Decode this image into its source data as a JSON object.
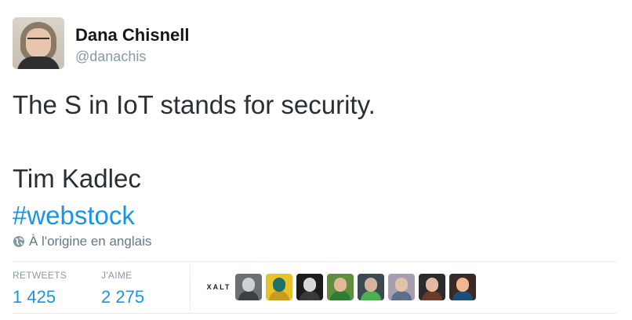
{
  "author": {
    "name": "Dana Chisnell",
    "handle": "@danachis"
  },
  "tweet": {
    "line1": "The S in IoT stands for security.",
    "line2": "Tim Kadlec",
    "hashtag": "#webstock"
  },
  "translate_label": "À l'origine en anglais",
  "stats": {
    "retweets_label": "RETWEETS",
    "retweets_value": "1 425",
    "likes_label": "J'AIME",
    "likes_value": "2 275"
  },
  "likers": {
    "first_label": "XALT",
    "avatar_colors": [
      [
        "#6a6f73",
        "#cfd2d4",
        "#3c4043"
      ],
      [
        "#e8c22a",
        "#1f6f6a",
        "#c99b1a"
      ],
      [
        "#1c1c1c",
        "#d8d8d8",
        "#3a3a3a"
      ],
      [
        "#5f8f3e",
        "#e2b79a",
        "#2e7d32"
      ],
      [
        "#3a4a52",
        "#d7b39b",
        "#4caf50"
      ],
      [
        "#a79eb1",
        "#e0c1a9",
        "#5d6f8a"
      ],
      [
        "#2b2b2b",
        "#e3b8a3",
        "#6b3b2a"
      ],
      [
        "#3a2a26",
        "#f0b68f",
        "#1b4f7a"
      ]
    ]
  },
  "colors": {
    "link": "#1b95e0",
    "muted": "#8899a6",
    "text": "#292f33"
  }
}
